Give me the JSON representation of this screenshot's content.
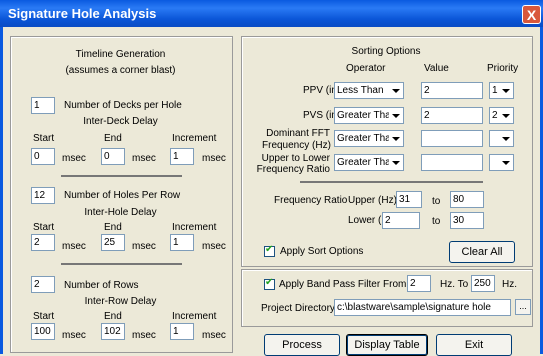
{
  "window": {
    "title": "Signature Hole Analysis",
    "close": "X"
  },
  "timeline": {
    "heading": "Timeline Generation",
    "subheading": "(assumes a corner blast)",
    "decks": {
      "value": "1",
      "label": "Number of Decks per Hole"
    },
    "interdeck": {
      "title": "Inter-Deck Delay",
      "start_label": "Start",
      "end_label": "End",
      "inc_label": "Increment",
      "start": "0",
      "end": "0",
      "inc": "1",
      "unit": "msec"
    },
    "holes": {
      "value": "12",
      "label": "Number of Holes Per Row"
    },
    "interhole": {
      "title": "Inter-Hole Delay",
      "start_label": "Start",
      "end_label": "End",
      "inc_label": "Increment",
      "start": "2",
      "end": "25",
      "inc": "1",
      "unit": "msec"
    },
    "rows": {
      "value": "2",
      "label": "Number of Rows"
    },
    "interrow": {
      "title": "Inter-Row Delay",
      "start_label": "Start",
      "end_label": "End",
      "inc_label": "Increment",
      "start": "100",
      "end": "102",
      "inc": "1",
      "unit": "msec"
    }
  },
  "sorting": {
    "heading": "Sorting Options",
    "col_operator": "Operator",
    "col_value": "Value",
    "col_priority": "Priority",
    "rows": [
      {
        "label": "PPV (in/s)",
        "operator": "Less Than",
        "value": "2",
        "priority": "1"
      },
      {
        "label": "PVS (in/s)",
        "operator": "Greater Than",
        "value": "2",
        "priority": "2"
      },
      {
        "label1": "Dominant FFT",
        "label2": "Frequency (Hz)",
        "operator": "Greater Than",
        "value": "",
        "priority": ""
      },
      {
        "label1": "Upper to Lower",
        "label2": "Frequency Ratio",
        "operator": "Greater Than",
        "value": "",
        "priority": ""
      }
    ],
    "freq_ratio_label": "Frequency Ratio",
    "upper_label": "Upper (Hz)",
    "upper_from": "31",
    "upper_to": "80",
    "lower_label": "Lower (Hz)",
    "lower_from": "2",
    "lower_to": "30",
    "to_label": "to",
    "apply_sort": "Apply Sort Options",
    "clear_all": "Clear All"
  },
  "bandpass": {
    "label": "Apply Band Pass Filter",
    "from_label": "From",
    "from": "2",
    "hz_to": "Hz.  To",
    "to": "250",
    "hz": "Hz."
  },
  "project": {
    "label": "Project Directory",
    "path": "c:\\blastware\\sample\\signature hole",
    "browse": "..."
  },
  "buttons": {
    "process": "Process",
    "display_table": "Display Table",
    "exit": "Exit"
  }
}
